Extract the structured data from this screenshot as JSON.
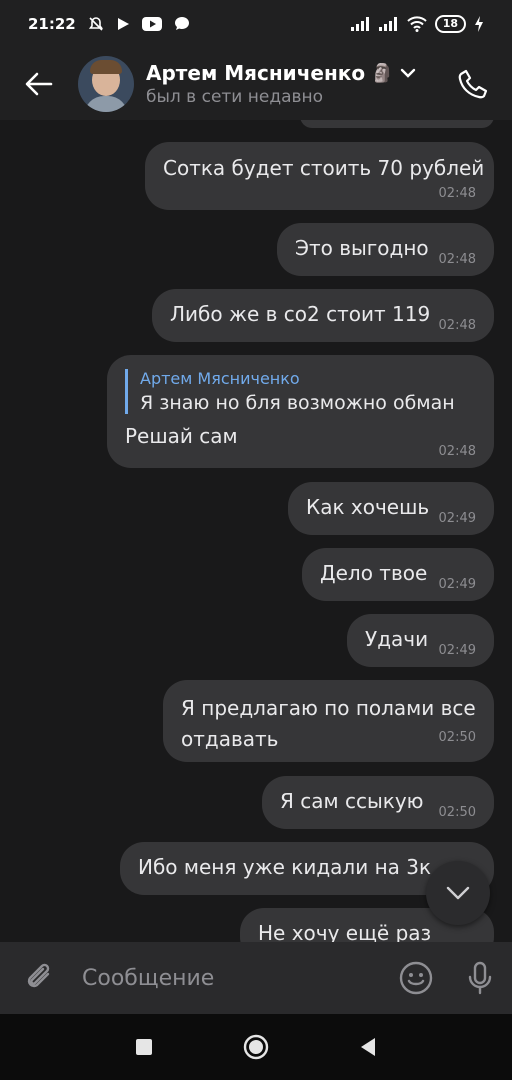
{
  "statusbar": {
    "time": "21:22",
    "battery": "18"
  },
  "header": {
    "contact_name": "Артем Мясниченко",
    "emoji": "🗿",
    "status": "был в сети недавно"
  },
  "messages": [
    {
      "text": "Сотка будет стоить 70 рублей",
      "time": "02:48"
    },
    {
      "text": "Это выгодно",
      "time": "02:48"
    },
    {
      "text": "Либо же в со2 стоит 119",
      "time": "02:48"
    },
    {
      "reply_name": "Артем Мясниченко",
      "reply_text": "Я знаю но бля возможно обман",
      "text": "Решай сам",
      "time": "02:48"
    },
    {
      "text": "Как хочешь",
      "time": "02:49"
    },
    {
      "text": "Дело твое",
      "time": "02:49"
    },
    {
      "text": "Удачи",
      "time": "02:49"
    },
    {
      "text_line1": "Я предлагаю по полами все",
      "text_line2": "отдавать",
      "time": "02:50"
    },
    {
      "text": "Я сам ссыкую",
      "time": "02:50"
    },
    {
      "text": "Ибо меня уже кидали на 3к",
      "time": ""
    },
    {
      "text": "Не хочу ещё раз",
      "time": ""
    }
  ],
  "composer": {
    "placeholder": "Сообщение"
  },
  "colors": {
    "background": "#19191a",
    "bubble": "#363638",
    "accent": "#71aaeb"
  },
  "icons": [
    "back-arrow-icon",
    "chevron-down-icon",
    "phone-icon",
    "paperclip-icon",
    "sticker-icon",
    "mic-icon",
    "scroll-down-icon",
    "nav-square-icon",
    "nav-circle-icon",
    "nav-back-icon"
  ]
}
